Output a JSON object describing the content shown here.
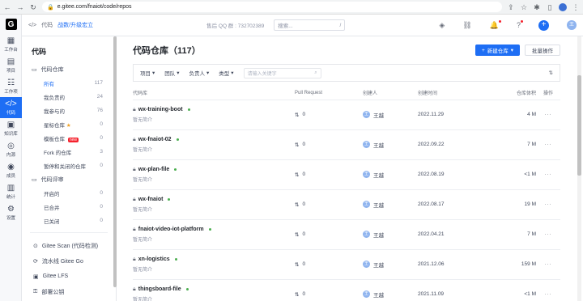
{
  "browser": {
    "url": "e.gitee.com/fnaiot/code/repos"
  },
  "rail": [
    {
      "icon": "▦",
      "label": "工作台",
      "name": "rail-workbench"
    },
    {
      "icon": "▤",
      "label": "项目",
      "name": "rail-project"
    },
    {
      "icon": "☷",
      "label": "工作项",
      "name": "rail-workitem"
    },
    {
      "icon": "</>",
      "label": "代码",
      "name": "rail-code",
      "active": true
    },
    {
      "icon": "▣",
      "label": "知识库",
      "name": "rail-wiki"
    },
    {
      "icon": "◎",
      "label": "内源",
      "name": "rail-innersource"
    },
    {
      "icon": "◉",
      "label": "成员",
      "name": "rail-members"
    },
    {
      "icon": "▥",
      "label": "统计",
      "name": "rail-stats"
    },
    {
      "icon": "⚙",
      "label": "设置",
      "name": "rail-settings"
    }
  ],
  "topbar": {
    "code_label": "代码",
    "enterprise": "战数/升级宏立",
    "hotline": "售后 QQ 群 : 732702389",
    "search_placeholder": "搜索...",
    "search_shortcut": "/"
  },
  "sidebar": {
    "title": "代码",
    "repo_section": "代码仓库",
    "items": [
      {
        "label": "所有",
        "count": "117",
        "active": true
      },
      {
        "label": "我负责的",
        "count": "24"
      },
      {
        "label": "我参与的",
        "count": "76"
      },
      {
        "label": "星标仓库",
        "count": "0",
        "star": true
      },
      {
        "label": "模板仓库",
        "count": "0",
        "badge": "new"
      },
      {
        "label": "Fork 的仓库",
        "count": "3"
      },
      {
        "label": "暂停和关闭的仓库",
        "count": "0"
      }
    ],
    "review_section": "代码评审",
    "review_items": [
      {
        "label": "开启的",
        "count": "0"
      },
      {
        "label": "已合并",
        "count": "0"
      },
      {
        "label": "已关闭",
        "count": "0"
      }
    ],
    "footer": [
      {
        "label": "Gitee Scan (代码检测)",
        "icon": "⊙"
      },
      {
        "label": "流水线 Gitee Go",
        "icon": "⟳"
      },
      {
        "label": "Gitee LFS",
        "icon": "▣"
      },
      {
        "label": "部署公钥",
        "icon": "⚿"
      }
    ]
  },
  "main": {
    "title": "代码仓库（117）",
    "new_button": "新建仓库",
    "batch_button": "批量操作",
    "filters": [
      "项目",
      "团队",
      "负责人",
      "类型"
    ],
    "filter_search_placeholder": "请输入关键字",
    "columns": [
      "代码库",
      "Pull Request",
      "创建人",
      "创建时间",
      "仓库体积",
      "操作"
    ],
    "rows": [
      {
        "name": "wx-training-boot",
        "desc": "暂无简介",
        "pr": "0",
        "creator": "王越",
        "date": "2022.11.29",
        "size": "4 M"
      },
      {
        "name": "wx-fnaiot-02",
        "desc": "暂无简介",
        "pr": "0",
        "creator": "王越",
        "date": "2022.09.22",
        "size": "7 M"
      },
      {
        "name": "wx-plan-file",
        "desc": "暂无简介",
        "pr": "0",
        "creator": "王越",
        "date": "2022.08.19",
        "size": "<1 M"
      },
      {
        "name": "wx-fnaiot",
        "desc": "暂无简介",
        "pr": "0",
        "creator": "王越",
        "date": "2022.08.17",
        "size": "19 M"
      },
      {
        "name": "fnaiot-video-iot-platform",
        "desc": "暂无简介",
        "pr": "0",
        "creator": "王越",
        "date": "2022.04.21",
        "size": "7 M"
      },
      {
        "name": "xn-logistics",
        "desc": "暂无简介",
        "pr": "0",
        "creator": "王越",
        "date": "2021.12.06",
        "size": "159 M"
      },
      {
        "name": "thingsboard-file",
        "desc": "暂无简介",
        "pr": "0",
        "creator": "王越",
        "date": "2021.11.09",
        "size": "<1 M"
      }
    ]
  }
}
